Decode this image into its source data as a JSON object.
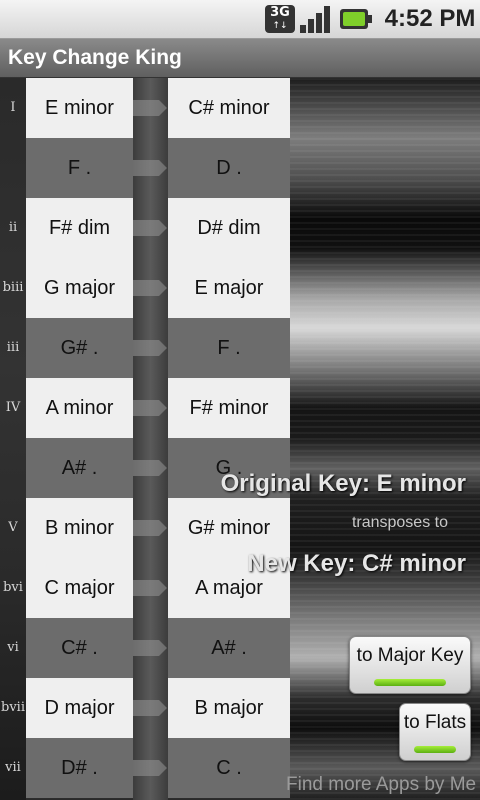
{
  "status_bar": {
    "network_label": "3G",
    "icons": [
      "network-3g-icon",
      "signal-strength-icon",
      "battery-charging-icon"
    ],
    "time": "4:52 PM"
  },
  "app": {
    "title": "Key Change King"
  },
  "rows": [
    {
      "numeral": "I",
      "original": "E minor",
      "transposed": "C# minor"
    },
    {
      "numeral": "",
      "original": "F .",
      "transposed": "D ."
    },
    {
      "numeral": "ii",
      "original": "F# dim",
      "transposed": "D# dim"
    },
    {
      "numeral": "biii",
      "original": "G major",
      "transposed": "E major"
    },
    {
      "numeral": "iii",
      "original": "G# .",
      "transposed": "F ."
    },
    {
      "numeral": "IV",
      "original": "A minor",
      "transposed": "F# minor"
    },
    {
      "numeral": "",
      "original": "A# .",
      "transposed": "G ."
    },
    {
      "numeral": "V",
      "original": "B minor",
      "transposed": "G# minor"
    },
    {
      "numeral": "bvi",
      "original": "C major",
      "transposed": "A major"
    },
    {
      "numeral": "vi",
      "original": "C# .",
      "transposed": "A# ."
    },
    {
      "numeral": "bvii",
      "original": "D major",
      "transposed": "B major"
    },
    {
      "numeral": "vii",
      "original": "D# .",
      "transposed": "C ."
    }
  ],
  "info": {
    "original_key": "Original Key: E minor",
    "transposes_to": "transposes to",
    "new_key": "New Key: C# minor"
  },
  "buttons": {
    "major_key": "to Major Key",
    "flats": "to Flats"
  },
  "footer": {
    "more_apps": "Find more Apps by Me"
  },
  "colors": {
    "cell_light": "#efefef",
    "cell_dark": "#6c6c6c",
    "indicator_green": "#7fcf2a"
  }
}
